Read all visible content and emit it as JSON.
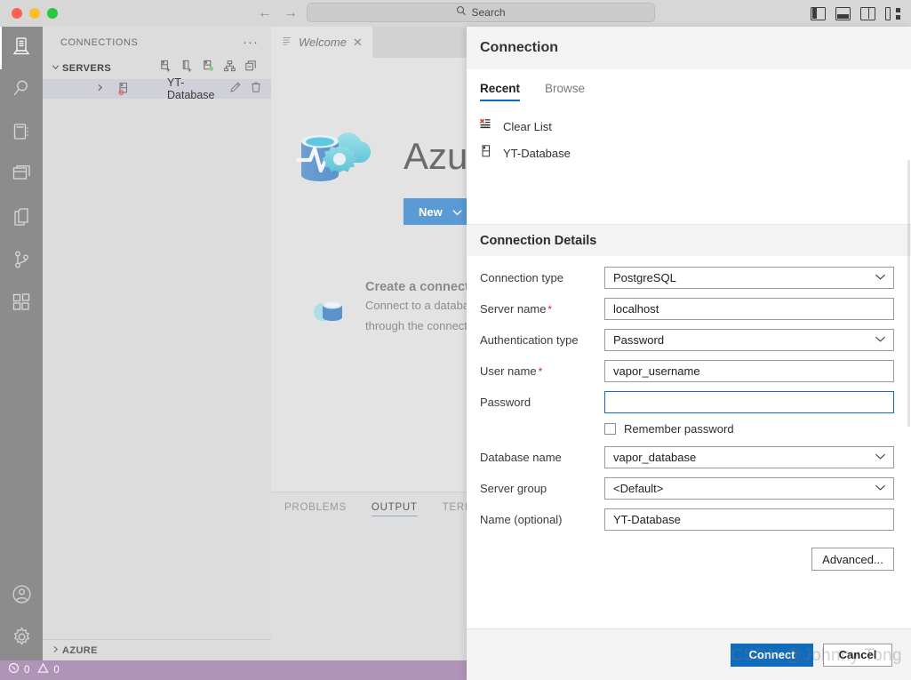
{
  "titlebar": {
    "nav_back": "←",
    "nav_forward": "→",
    "search_label": "Search",
    "layout_icons": [
      {
        "name": "toggle-primary-sidebar",
        "label": "Toggle Primary Side Bar"
      },
      {
        "name": "toggle-panel",
        "label": "Toggle Panel"
      },
      {
        "name": "toggle-secondary-sidebar",
        "label": "Toggle Secondary Side Bar"
      },
      {
        "name": "customize-layout",
        "label": "Customize Layout"
      }
    ]
  },
  "activitybar": {
    "items": [
      {
        "name": "servers",
        "icon": "server-icon",
        "active": true
      },
      {
        "name": "search",
        "icon": "search-icon",
        "active": false
      },
      {
        "name": "notebooks",
        "icon": "notebook-icon",
        "active": false
      },
      {
        "name": "dashboards",
        "icon": "window-icon",
        "active": false
      },
      {
        "name": "files",
        "icon": "files-icon",
        "active": false
      },
      {
        "name": "source-control",
        "icon": "source-control-icon",
        "active": false
      },
      {
        "name": "extensions",
        "icon": "extensions-icon",
        "active": false
      }
    ],
    "bottom": [
      {
        "name": "accounts",
        "icon": "account-icon"
      },
      {
        "name": "manage",
        "icon": "gear-icon"
      }
    ]
  },
  "sidebar": {
    "title": "CONNECTIONS",
    "more_actions": "···",
    "section": {
      "label": "SERVERS",
      "expanded": true,
      "tools": [
        {
          "name": "new-connection-icon"
        },
        {
          "name": "new-query-icon"
        },
        {
          "name": "new-server-group-icon"
        },
        {
          "name": "server-group-tree-icon"
        },
        {
          "name": "collapse-all-icon"
        }
      ]
    },
    "servers": [
      {
        "label": "YT-Database",
        "status": "disconnected",
        "actions": [
          {
            "name": "edit-icon"
          },
          {
            "name": "delete-icon"
          }
        ]
      }
    ],
    "azure_section": {
      "label": "AZURE",
      "expanded": false
    }
  },
  "editor": {
    "tabs": [
      {
        "label": "Welcome",
        "active": true,
        "close": "✕"
      }
    ],
    "welcome": {
      "brand": "Azure",
      "new_button": "New",
      "new_caret": "⌄",
      "card": {
        "title": "Create a connection",
        "desc_line1": "Connect to a database i",
        "desc_line2": "through the connection"
      }
    },
    "panel_tabs": [
      {
        "label": "PROBLEMS",
        "active": false
      },
      {
        "label": "OUTPUT",
        "active": true
      },
      {
        "label": "TERMINAL",
        "active": false
      }
    ]
  },
  "statusbar": {
    "errors_icon": "error-circle-icon",
    "errors": "0",
    "warnings_icon": "warning-triangle-icon",
    "warnings": "0"
  },
  "dialog": {
    "title": "Connection",
    "tabs": [
      {
        "label": "Recent",
        "active": true
      },
      {
        "label": "Browse",
        "active": false
      }
    ],
    "recent_items": [
      {
        "label": "Clear List",
        "icon": "clear-list-icon"
      },
      {
        "label": "YT-Database",
        "icon": "server-icon"
      }
    ],
    "details_title": "Connection Details",
    "fields": [
      {
        "name": "connection-type",
        "label": "Connection type",
        "required": false,
        "type": "select",
        "value": "PostgreSQL"
      },
      {
        "name": "server-name",
        "label": "Server name",
        "required": true,
        "type": "text",
        "value": "localhost"
      },
      {
        "name": "authentication-type",
        "label": "Authentication type",
        "required": false,
        "type": "select",
        "value": "Password"
      },
      {
        "name": "user-name",
        "label": "User name",
        "required": true,
        "type": "text",
        "value": "vapor_username"
      },
      {
        "name": "password",
        "label": "Password",
        "required": false,
        "type": "password",
        "value": "",
        "focused": true
      }
    ],
    "remember_password": {
      "label": "Remember password",
      "checked": false
    },
    "fields2": [
      {
        "name": "database-name",
        "label": "Database name",
        "required": false,
        "type": "select",
        "value": "vapor_database"
      },
      {
        "name": "server-group",
        "label": "Server group",
        "required": false,
        "type": "select",
        "value": "<Default>"
      },
      {
        "name": "name-optional",
        "label": "Name (optional)",
        "required": false,
        "type": "text",
        "value": "YT-Database"
      }
    ],
    "advanced_button": "Advanced...",
    "connect_button": "Connect",
    "cancel_button": "Cancel",
    "required_marker": "*",
    "caret": "⌄"
  },
  "watermark": "CSDN @Johnny Tong",
  "colors": {
    "accent_blue": "#0f6cbd",
    "tab_underline": "#0f6cbd",
    "statusbar": "#b094b8",
    "activitybar": "#8c8c8c",
    "azure_button": "#5b9bd5",
    "required_red": "#e01b24"
  }
}
